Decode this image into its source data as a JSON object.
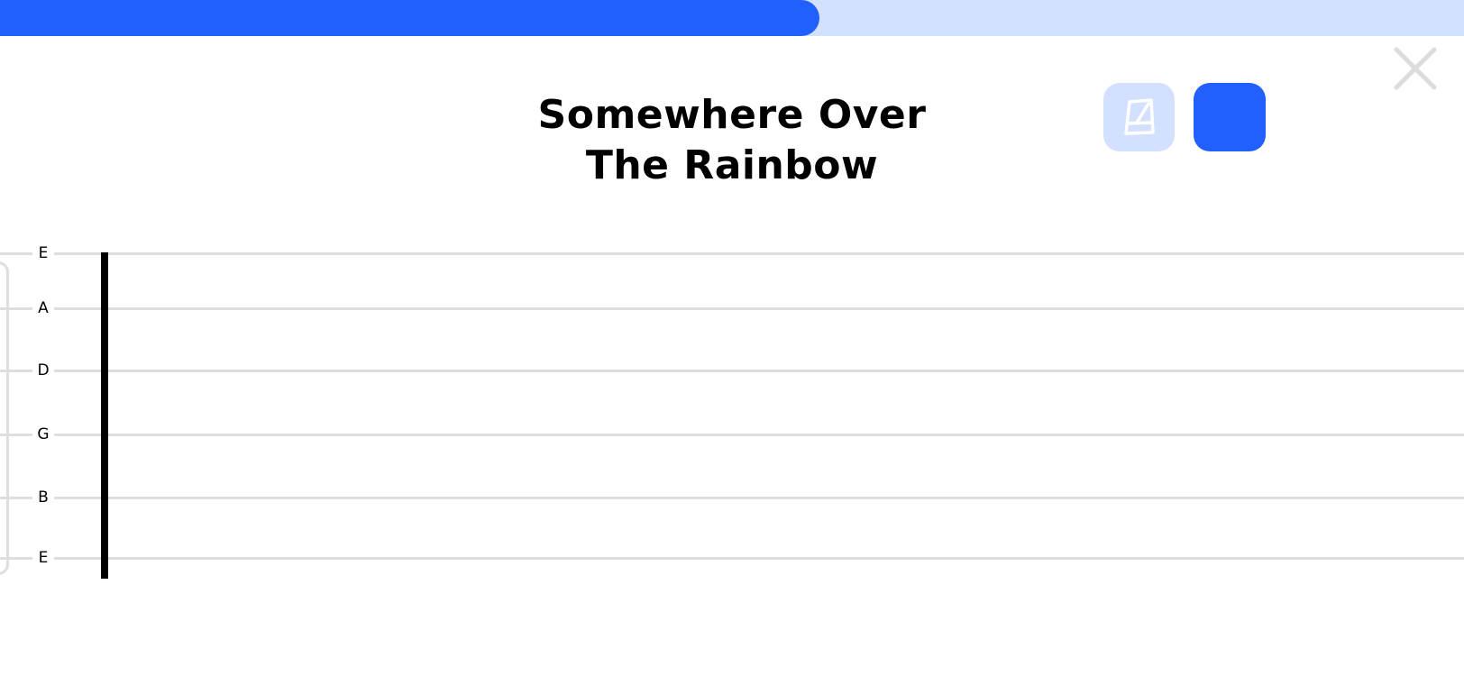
{
  "progress": {
    "value": 0.56,
    "fill_color": "#2160ff",
    "track_color": "#d4e0ff"
  },
  "header": {
    "title_line1": "Somewhere Over",
    "title_line2": "The Rainbow"
  },
  "actions": {
    "tuner_icon": "metronome-icon",
    "tuner_bg": "#d4e0ff",
    "primary_bg": "#2160ff"
  },
  "close": {
    "icon": "close-icon",
    "color": "#dcdcdc"
  },
  "tab": {
    "strings": [
      "E",
      "A",
      "D",
      "G",
      "B",
      "E"
    ]
  }
}
